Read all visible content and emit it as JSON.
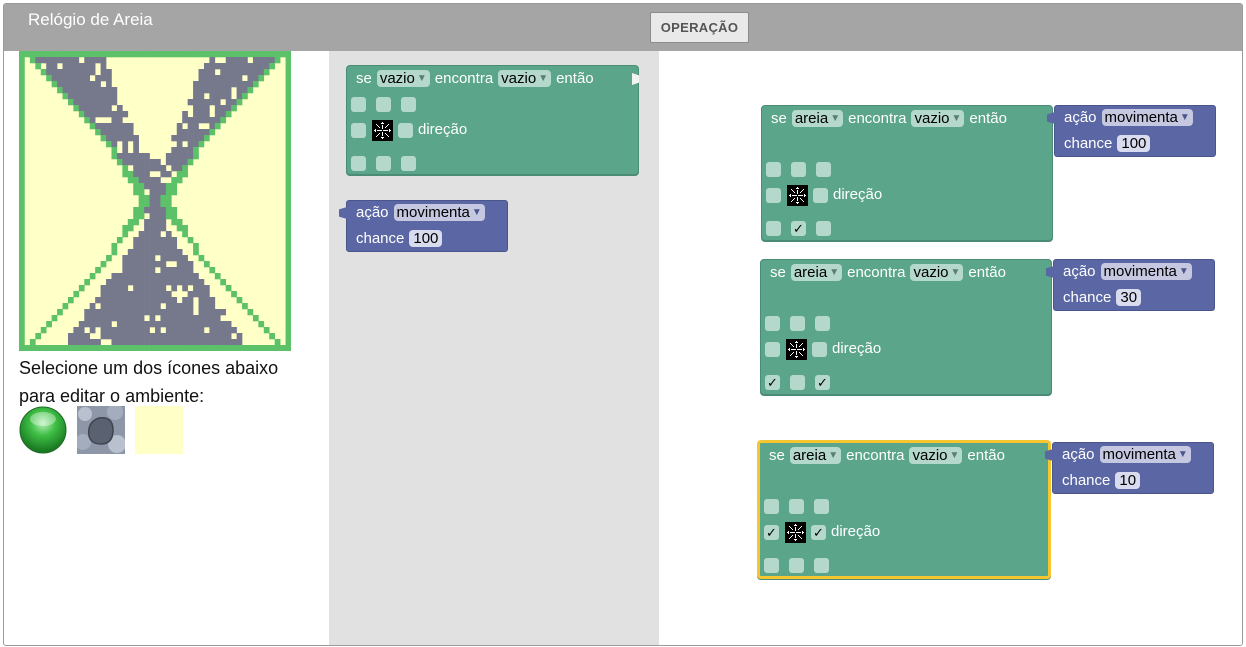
{
  "app": {
    "title": "Relógio de Areia",
    "operation_button": "OPERAÇÃO"
  },
  "left": {
    "instruction_line1": "Selecione um dos ícones abaixo",
    "instruction_line2": "para editar o ambiente:",
    "palette": [
      "wall",
      "sand",
      "empty"
    ],
    "colors": {
      "wall": "#5dc16a",
      "sand": "#76788c",
      "empty": "#ffffc8"
    }
  },
  "toolbox": {
    "rule": {
      "se": "se",
      "subject": "vazio",
      "encontra": "encontra",
      "object": "vazio",
      "entao": "então",
      "direcao": "direção"
    },
    "action": {
      "acao": "ação",
      "type": "movimenta",
      "chance_label": "chance",
      "chance": "100"
    }
  },
  "workspace": {
    "rules": [
      {
        "se": "se",
        "subject": "areia",
        "encontra": "encontra",
        "object": "vazio",
        "entao": "então",
        "direcao": "direção",
        "checks": [
          [
            false,
            false,
            false
          ],
          [
            false,
            null,
            false
          ],
          [
            false,
            true,
            false
          ]
        ],
        "action": {
          "acao": "ação",
          "type": "movimenta",
          "chance_label": "chance",
          "chance": "100"
        }
      },
      {
        "se": "se",
        "subject": "areia",
        "encontra": "encontra",
        "object": "vazio",
        "entao": "então",
        "direcao": "direção",
        "checks": [
          [
            false,
            false,
            false
          ],
          [
            false,
            null,
            false
          ],
          [
            true,
            false,
            true
          ]
        ],
        "action": {
          "acao": "ação",
          "type": "movimenta",
          "chance_label": "chance",
          "chance": "30"
        }
      },
      {
        "se": "se",
        "subject": "areia",
        "encontra": "encontra",
        "object": "vazio",
        "entao": "então",
        "direcao": "direção",
        "checks": [
          [
            false,
            false,
            false
          ],
          [
            true,
            null,
            true
          ],
          [
            false,
            false,
            false
          ]
        ],
        "action": {
          "acao": "ação",
          "type": "movimenta",
          "chance_label": "chance",
          "chance": "10"
        }
      }
    ]
  }
}
